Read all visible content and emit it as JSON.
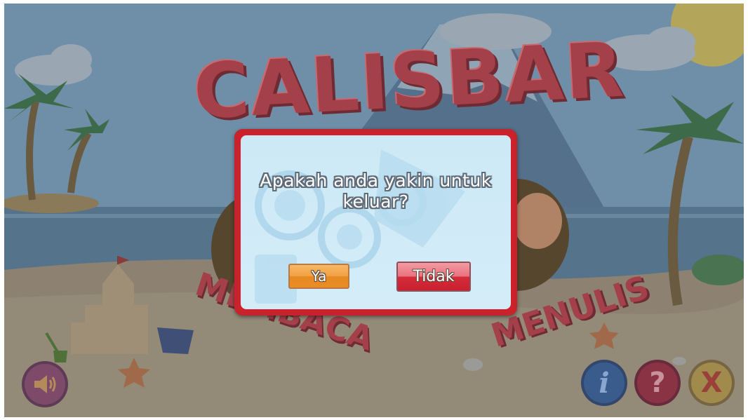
{
  "game": {
    "logo_title": "CALISBAR",
    "logo_sub_left": "MEMBACA",
    "logo_sub_right": "MENULIS"
  },
  "bottom_buttons": {
    "info_label": "i",
    "help_label": "?",
    "exit_label": "X"
  },
  "dialog": {
    "message": "Apakah anda yakin untuk keluar?",
    "yes_label": "Ya",
    "no_label": "Tidak"
  },
  "colors": {
    "dialog_border": "#d11f2b",
    "dialog_bg": "#cde9f6",
    "yes_button": "#f2a042",
    "no_button": "#d52c3b"
  }
}
